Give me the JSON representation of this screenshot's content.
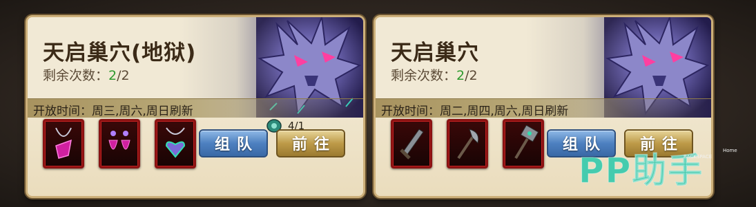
{
  "cards": [
    {
      "title": "天启巢穴(地狱)",
      "remain_label": "剩余次数：",
      "remain_current": "2",
      "remain_total": "/2",
      "open_time": "开放时间：周三,周六,周日刷新",
      "key_count": "4/1",
      "team_label": "组队",
      "go_label": "前往",
      "items": [
        "amulet-necklace-icon",
        "earrings-icon",
        "heart-necklace-icon"
      ]
    },
    {
      "title": "天启巢穴",
      "remain_label": "剩余次数：",
      "remain_current": "2",
      "remain_total": "/2",
      "open_time": "开放时间：周二,周四,周六,周日刷新",
      "team_label": "组队",
      "go_label": "前往",
      "items": [
        "broken-sword-icon",
        "axe-icon",
        "hammer-icon"
      ]
    }
  ],
  "watermark": "PP助手",
  "overlay_home": "Home",
  "overlay_backspace": "BACKSPACE",
  "colors": {
    "remain_current": "#2f9a2e",
    "team_button": "#4d80c0",
    "go_button": "#bd9a48",
    "item_border": "#8a1212"
  }
}
